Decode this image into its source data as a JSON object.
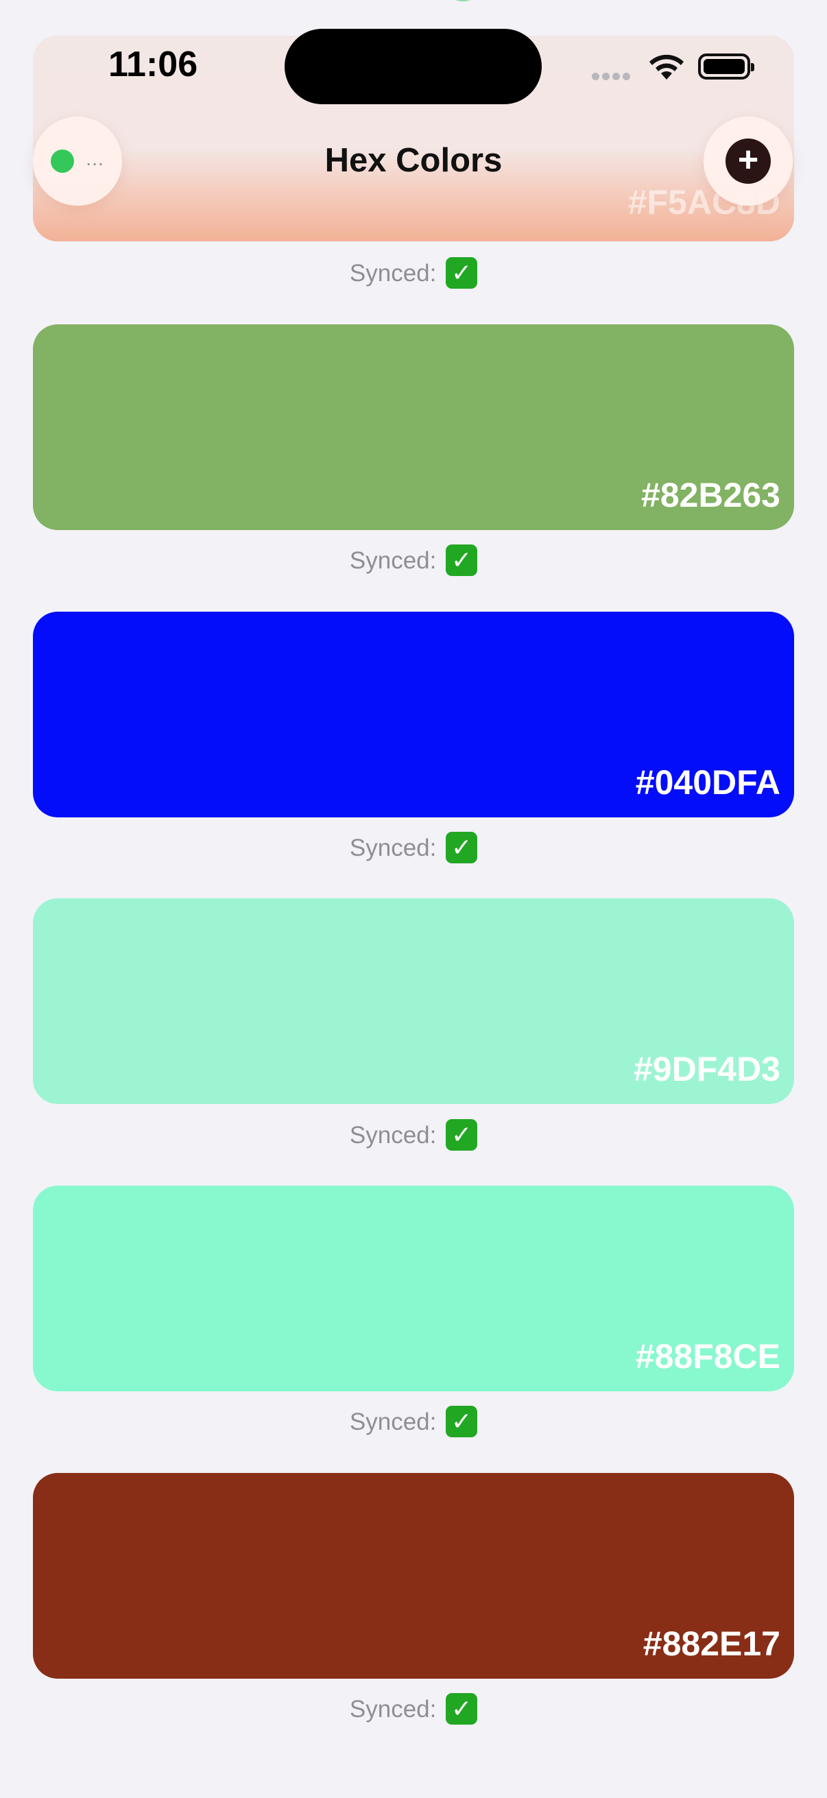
{
  "status_bar": {
    "time": "11:06"
  },
  "header": {
    "title": "Hex Colors"
  },
  "synced_label": "Synced:",
  "synced_icon": "✓",
  "colors": [
    {
      "hex": "#F5AC8D",
      "color": "#F5AC8D"
    },
    {
      "hex": "#82B263",
      "color": "#82B263"
    },
    {
      "hex": "#040DFA",
      "color": "#040DFA"
    },
    {
      "hex": "#9DF4D3",
      "color": "#9DF4D3"
    },
    {
      "hex": "#88F8CE",
      "color": "#88F8CE"
    },
    {
      "hex": "#882E17",
      "color": "#882E17"
    }
  ]
}
